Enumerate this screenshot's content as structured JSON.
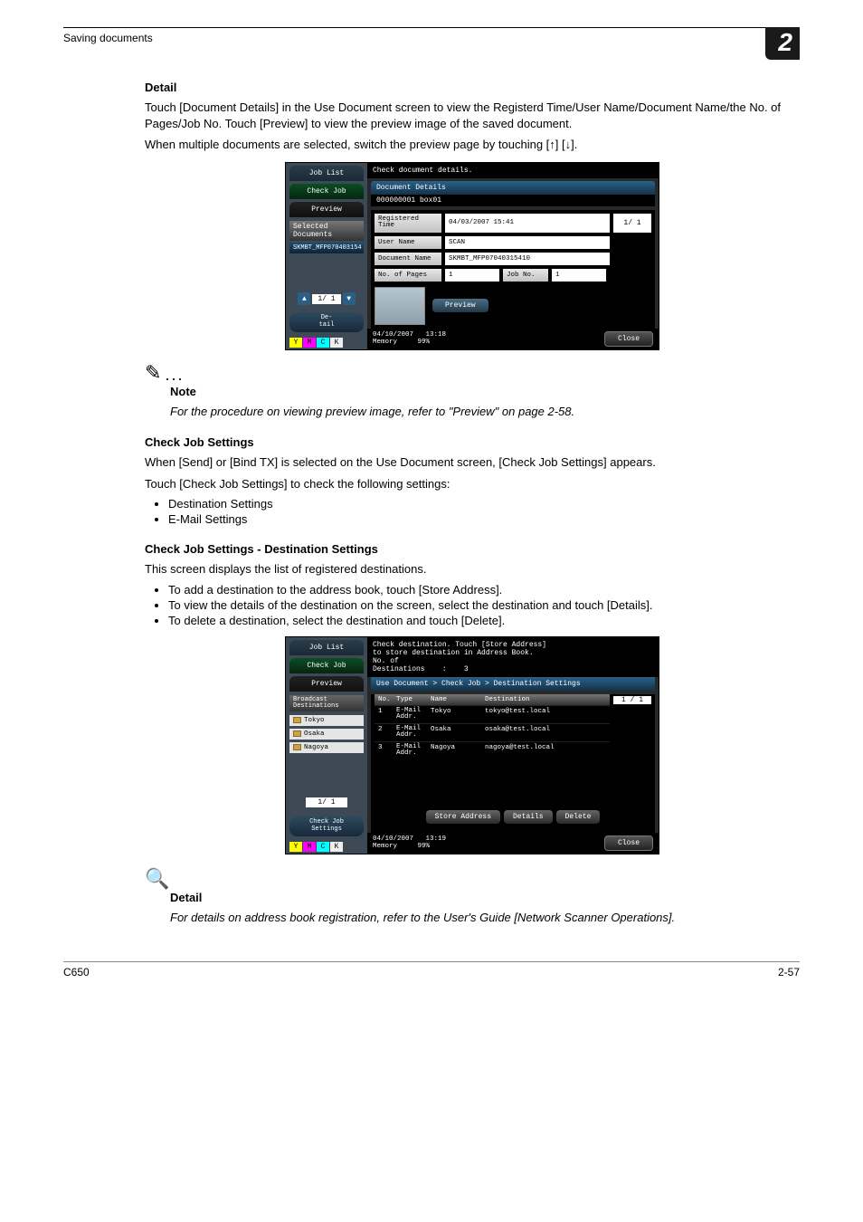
{
  "header": {
    "section": "Saving documents",
    "page_badge": "2"
  },
  "sec1": {
    "heading": "Detail",
    "p1": "Touch [Document Details] in the Use Document screen to view the Registerd Time/User Name/Document Name/the No. of Pages/Job No. Touch [Preview] to view the preview image of the saved document.",
    "p2": "When multiple documents are selected, switch the preview page by touching [↑] [↓]."
  },
  "shot1": {
    "left": {
      "job_list": "Job List",
      "check_job": "Check Job",
      "preview": "Preview",
      "sel_hdr": "Selected Documents",
      "sel_item": "SKMBT_MFP070403154",
      "page": "1/  1",
      "detail_btn": "De-\ntail"
    },
    "top_msg": "Check document details.",
    "doc_details_bar": "Document Details",
    "doc_sub": "000000001  box01",
    "fields": {
      "registered_lbl": "Registered\nTime",
      "registered_val": "04/03/2007 15:41",
      "user_lbl": "User Name",
      "user_val": "SCAN",
      "doc_lbl": "Document Name",
      "doc_val": "SKMBT_MFP07040315410",
      "pages_lbl": "No. of Pages",
      "pages_val": "1",
      "jobno_lbl": "Job No.",
      "jobno_val": "1",
      "page11": "1/  1"
    },
    "preview_btn": "Preview",
    "status": {
      "date": "04/10/2007",
      "time": "13:18",
      "mem_lbl": "Memory",
      "mem_val": "99%"
    },
    "close": "Close"
  },
  "note1": {
    "note": "Note",
    "text": "For the procedure on viewing preview image, refer to \"Preview\" on page 2-58."
  },
  "sec2": {
    "heading": "Check Job Settings",
    "p1": "When [Send] or [Bind TX] is selected on the Use Document screen, [Check Job Settings] appears.",
    "p2": "Touch [Check Job Settings] to check the following settings:",
    "b1": "Destination Settings",
    "b2": "E-Mail Settings"
  },
  "sec3": {
    "heading": "Check Job Settings - Destination Settings",
    "p1": "This screen displays the list of registered destinations.",
    "b1": "To add a destination to the address book, touch [Store Address].",
    "b2": "To view the details of the destination on the screen, select the destination and touch [Details].",
    "b3": "To delete a destination, select the destination and touch [Delete]."
  },
  "shot2": {
    "left": {
      "job_list": "Job List",
      "check_job": "Check Job",
      "preview": "Preview",
      "bcast": "Broadcast\nDestinations",
      "d1": "Tokyo",
      "d2": "Osaka",
      "d3": "Nagoya",
      "page": "1/  1",
      "detail_btn": "Check Job\nSettings"
    },
    "top_msg1": "Check destination. Touch [Store Address]",
    "top_msg2": "to store destination in Address Book.",
    "count_lbl": "No. of\nDestinations",
    "count_sep": ":",
    "count_val": "3",
    "crumb": "Use Document > Check Job > Destination Settings",
    "th": {
      "no": "No.",
      "type": "Type",
      "name": "Name",
      "dest": "Destination"
    },
    "rows": [
      {
        "no": "1",
        "type": "E-Mail\nAddr.",
        "name": "Tokyo",
        "dest": "tokyo@test.local"
      },
      {
        "no": "2",
        "type": "E-Mail\nAddr.",
        "name": "Osaka",
        "dest": "osaka@test.local"
      },
      {
        "no": "3",
        "type": "E-Mail\nAddr.",
        "name": "Nagoya",
        "dest": "nagoya@test.local"
      }
    ],
    "page_right": "1 / 1",
    "btns": {
      "store": "Store Address",
      "details": "Details",
      "delete": "Delete"
    },
    "status": {
      "date": "04/10/2007",
      "time": "13:19",
      "mem_lbl": "Memory",
      "mem_val": "99%"
    },
    "close": "Close"
  },
  "detail2": {
    "heading": "Detail",
    "text": "For details on address book registration, refer to the User's Guide [Network Scanner Operations]."
  },
  "footer": {
    "left": "C650",
    "right": "2-57"
  }
}
